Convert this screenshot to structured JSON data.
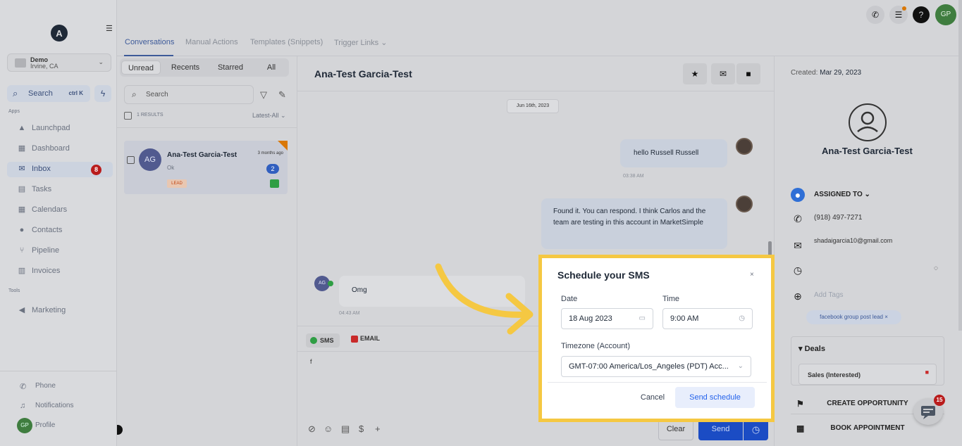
{
  "sidebar": {
    "location_name": "Demo",
    "location_sub": "Irvine, CA",
    "search_label": "Search",
    "search_shortcut": "ctrl K",
    "section_apps": "Apps",
    "section_tools": "Tools",
    "items": [
      {
        "label": "Launchpad"
      },
      {
        "label": "Dashboard"
      },
      {
        "label": "Inbox",
        "badge": "8"
      },
      {
        "label": "Tasks"
      },
      {
        "label": "Calendars"
      },
      {
        "label": "Contacts"
      },
      {
        "label": "Pipeline"
      },
      {
        "label": "Invoices"
      },
      {
        "label": "Marketing"
      }
    ],
    "bottom": {
      "phone": "Phone",
      "notifications": "Notifications",
      "profile": "Profile",
      "profile_initials": "GP"
    }
  },
  "topbar": {
    "avatar_initials": "GP"
  },
  "tabs": [
    "Conversations",
    "Manual Actions",
    "Templates (Snippets)",
    "Trigger Links"
  ],
  "conversations": {
    "filters": [
      "Unread",
      "Recents",
      "Starred",
      "All"
    ],
    "search_placeholder": "Search",
    "results": "1 RESULTS",
    "sort": "Latest-All",
    "items": [
      {
        "initials": "AG",
        "name": "Ana-Test Garcia-Test",
        "time": "3 months ago",
        "preview": "Ok",
        "count": "2",
        "tag": "LEAD"
      }
    ]
  },
  "chat": {
    "contact_name": "Ana-Test Garcia-Test",
    "date_divider": "Jun 16th, 2023",
    "messages": [
      {
        "text": "hello Russell Russell",
        "time": "03:38 AM",
        "direction": "out"
      },
      {
        "text": "Found it. You can respond.  I think Carlos and the team are testing in this  account in MarketSimple",
        "time": "",
        "direction": "out"
      },
      {
        "text": "Omg",
        "time": "04:43 AM",
        "direction": "in",
        "initials": "AG"
      }
    ],
    "channel_tabs": [
      "SMS",
      "EMAIL"
    ],
    "composer_text": "f",
    "clear_label": "Clear",
    "send_label": "Send"
  },
  "modal": {
    "title": "Schedule your SMS",
    "close": "×",
    "date_label": "Date",
    "date_value": "18 Aug 2023",
    "time_label": "Time",
    "time_value": "9:00 AM",
    "timezone_label": "Timezone (Account)",
    "timezone_value": "GMT-07:00 America/Los_Angeles (PDT) Acc...",
    "cancel_label": "Cancel",
    "send_label": "Send schedule"
  },
  "contact": {
    "created_label": "Created:",
    "created_date": "Mar 29, 2023",
    "name": "Ana-Test Garcia-Test",
    "assigned_to": "ASSIGNED TO",
    "phone": "(918) 497-7271",
    "email": "shadaigarcia10@gmail.com",
    "add_tags": "Add Tags",
    "tag": "facebook group post lead",
    "deals_label": "Deals",
    "deal_item": "Sales (Interested)",
    "create_opportunity": "CREATE OPPORTUNITY",
    "book_appointment": "BOOK APPOINTMENT",
    "chat_badge": "15"
  },
  "colors": {
    "highlight": "#f5c842",
    "accent": "#1b4cc4",
    "arrow": "#f5c842"
  }
}
